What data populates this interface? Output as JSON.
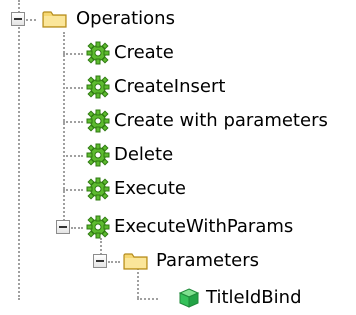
{
  "tree": {
    "root": {
      "label": "Operations",
      "icon": "folder-icon",
      "expanded": true
    },
    "operations": [
      {
        "label": "Create",
        "icon": "gear-icon"
      },
      {
        "label": "CreateInsert",
        "icon": "gear-icon"
      },
      {
        "label": "Create with parameters",
        "icon": "gear-icon"
      },
      {
        "label": "Delete",
        "icon": "gear-icon"
      },
      {
        "label": "Execute",
        "icon": "gear-icon"
      },
      {
        "label": "ExecuteWithParams",
        "icon": "gear-icon",
        "expanded": true
      }
    ],
    "parameters_folder": {
      "label": "Parameters",
      "icon": "folder-icon",
      "expanded": true
    },
    "parameter": {
      "label": "TitleIdBind",
      "icon": "green-cube-icon"
    }
  },
  "colors": {
    "folder": "#f6d770",
    "folder_edge": "#b58c1e",
    "gear": "#5dbb2f",
    "gear_edge": "#2f7a12",
    "cube": "#35c15a",
    "connector": "#a0a0a0"
  }
}
